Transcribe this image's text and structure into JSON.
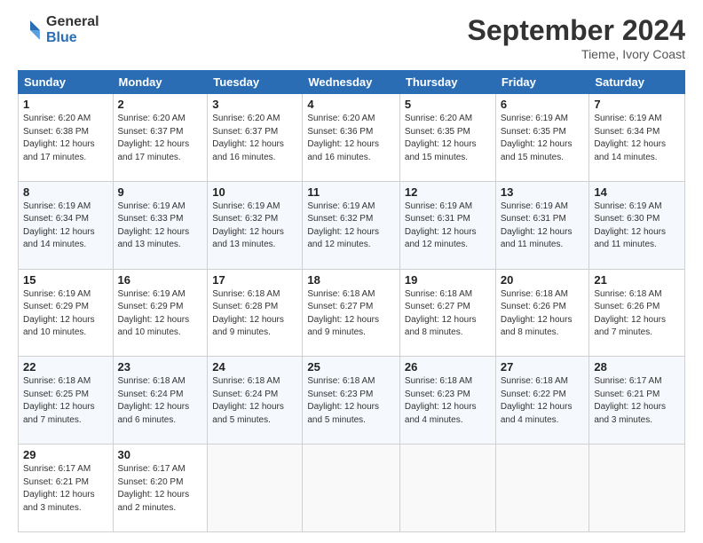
{
  "header": {
    "logo_line1": "General",
    "logo_line2": "Blue",
    "month_title": "September 2024",
    "location": "Tieme, Ivory Coast"
  },
  "weekdays": [
    "Sunday",
    "Monday",
    "Tuesday",
    "Wednesday",
    "Thursday",
    "Friday",
    "Saturday"
  ],
  "weeks": [
    [
      {
        "day": "1",
        "sunrise": "6:20 AM",
        "sunset": "6:38 PM",
        "daylight": "12 hours and 17 minutes."
      },
      {
        "day": "2",
        "sunrise": "6:20 AM",
        "sunset": "6:37 PM",
        "daylight": "12 hours and 17 minutes."
      },
      {
        "day": "3",
        "sunrise": "6:20 AM",
        "sunset": "6:37 PM",
        "daylight": "12 hours and 16 minutes."
      },
      {
        "day": "4",
        "sunrise": "6:20 AM",
        "sunset": "6:36 PM",
        "daylight": "12 hours and 16 minutes."
      },
      {
        "day": "5",
        "sunrise": "6:20 AM",
        "sunset": "6:35 PM",
        "daylight": "12 hours and 15 minutes."
      },
      {
        "day": "6",
        "sunrise": "6:19 AM",
        "sunset": "6:35 PM",
        "daylight": "12 hours and 15 minutes."
      },
      {
        "day": "7",
        "sunrise": "6:19 AM",
        "sunset": "6:34 PM",
        "daylight": "12 hours and 14 minutes."
      }
    ],
    [
      {
        "day": "8",
        "sunrise": "6:19 AM",
        "sunset": "6:34 PM",
        "daylight": "12 hours and 14 minutes."
      },
      {
        "day": "9",
        "sunrise": "6:19 AM",
        "sunset": "6:33 PM",
        "daylight": "12 hours and 13 minutes."
      },
      {
        "day": "10",
        "sunrise": "6:19 AM",
        "sunset": "6:32 PM",
        "daylight": "12 hours and 13 minutes."
      },
      {
        "day": "11",
        "sunrise": "6:19 AM",
        "sunset": "6:32 PM",
        "daylight": "12 hours and 12 minutes."
      },
      {
        "day": "12",
        "sunrise": "6:19 AM",
        "sunset": "6:31 PM",
        "daylight": "12 hours and 12 minutes."
      },
      {
        "day": "13",
        "sunrise": "6:19 AM",
        "sunset": "6:31 PM",
        "daylight": "12 hours and 11 minutes."
      },
      {
        "day": "14",
        "sunrise": "6:19 AM",
        "sunset": "6:30 PM",
        "daylight": "12 hours and 11 minutes."
      }
    ],
    [
      {
        "day": "15",
        "sunrise": "6:19 AM",
        "sunset": "6:29 PM",
        "daylight": "12 hours and 10 minutes."
      },
      {
        "day": "16",
        "sunrise": "6:19 AM",
        "sunset": "6:29 PM",
        "daylight": "12 hours and 10 minutes."
      },
      {
        "day": "17",
        "sunrise": "6:18 AM",
        "sunset": "6:28 PM",
        "daylight": "12 hours and 9 minutes."
      },
      {
        "day": "18",
        "sunrise": "6:18 AM",
        "sunset": "6:27 PM",
        "daylight": "12 hours and 9 minutes."
      },
      {
        "day": "19",
        "sunrise": "6:18 AM",
        "sunset": "6:27 PM",
        "daylight": "12 hours and 8 minutes."
      },
      {
        "day": "20",
        "sunrise": "6:18 AM",
        "sunset": "6:26 PM",
        "daylight": "12 hours and 8 minutes."
      },
      {
        "day": "21",
        "sunrise": "6:18 AM",
        "sunset": "6:26 PM",
        "daylight": "12 hours and 7 minutes."
      }
    ],
    [
      {
        "day": "22",
        "sunrise": "6:18 AM",
        "sunset": "6:25 PM",
        "daylight": "12 hours and 7 minutes."
      },
      {
        "day": "23",
        "sunrise": "6:18 AM",
        "sunset": "6:24 PM",
        "daylight": "12 hours and 6 minutes."
      },
      {
        "day": "24",
        "sunrise": "6:18 AM",
        "sunset": "6:24 PM",
        "daylight": "12 hours and 5 minutes."
      },
      {
        "day": "25",
        "sunrise": "6:18 AM",
        "sunset": "6:23 PM",
        "daylight": "12 hours and 5 minutes."
      },
      {
        "day": "26",
        "sunrise": "6:18 AM",
        "sunset": "6:23 PM",
        "daylight": "12 hours and 4 minutes."
      },
      {
        "day": "27",
        "sunrise": "6:18 AM",
        "sunset": "6:22 PM",
        "daylight": "12 hours and 4 minutes."
      },
      {
        "day": "28",
        "sunrise": "6:17 AM",
        "sunset": "6:21 PM",
        "daylight": "12 hours and 3 minutes."
      }
    ],
    [
      {
        "day": "29",
        "sunrise": "6:17 AM",
        "sunset": "6:21 PM",
        "daylight": "12 hours and 3 minutes."
      },
      {
        "day": "30",
        "sunrise": "6:17 AM",
        "sunset": "6:20 PM",
        "daylight": "12 hours and 2 minutes."
      },
      null,
      null,
      null,
      null,
      null
    ]
  ]
}
